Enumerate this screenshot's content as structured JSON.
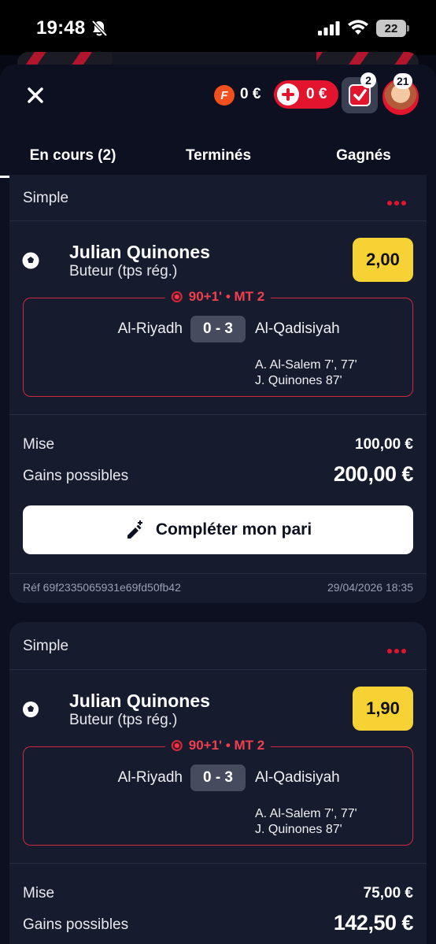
{
  "status_bar": {
    "time": "19:48",
    "battery": "22"
  },
  "header": {
    "f_points": "0 €",
    "bonus_balance": "0 €",
    "bets_count": "2",
    "notifications_count": "21"
  },
  "tabs": [
    {
      "label": "En cours (2)",
      "active": true
    },
    {
      "label": "Terminés",
      "active": false
    },
    {
      "label": "Gagnés",
      "active": false
    }
  ],
  "bets": [
    {
      "type": "Simple",
      "player": "Julian Quinones",
      "market": "Buteur (tps rég.)",
      "odds": "2,00",
      "live_status": "90+1' • MT 2",
      "home_team": "Al-Riyadh",
      "score": "0 - 3",
      "away_team": "Al-Qadisiyah",
      "scorers": [
        "A. Al-Salem 7', 77'",
        "J. Quinones 87'"
      ],
      "stake_label": "Mise",
      "stake": "100,00 €",
      "gains_label": "Gains possibles",
      "gains": "200,00 €",
      "complete_label": "Compléter mon pari",
      "ref": "Réf 69f2335065931e69fd50fb42",
      "date": "29/04/2026 18:35"
    },
    {
      "type": "Simple",
      "player": "Julian Quinones",
      "market": "Buteur (tps rég.)",
      "odds": "1,90",
      "live_status": "90+1' • MT 2",
      "home_team": "Al-Riyadh",
      "score": "0 - 3",
      "away_team": "Al-Qadisiyah",
      "scorers": [
        "A. Al-Salem 7', 77'",
        "J. Quinones 87'"
      ],
      "stake_label": "Mise",
      "stake": "75,00 €",
      "gains_label": "Gains possibles",
      "gains": "142,50 €"
    }
  ],
  "colors": {
    "accent_red": "#e3142d",
    "odds_yellow": "#f7d235",
    "card_bg": "#161b2e",
    "sheet_bg": "#0c1020"
  }
}
